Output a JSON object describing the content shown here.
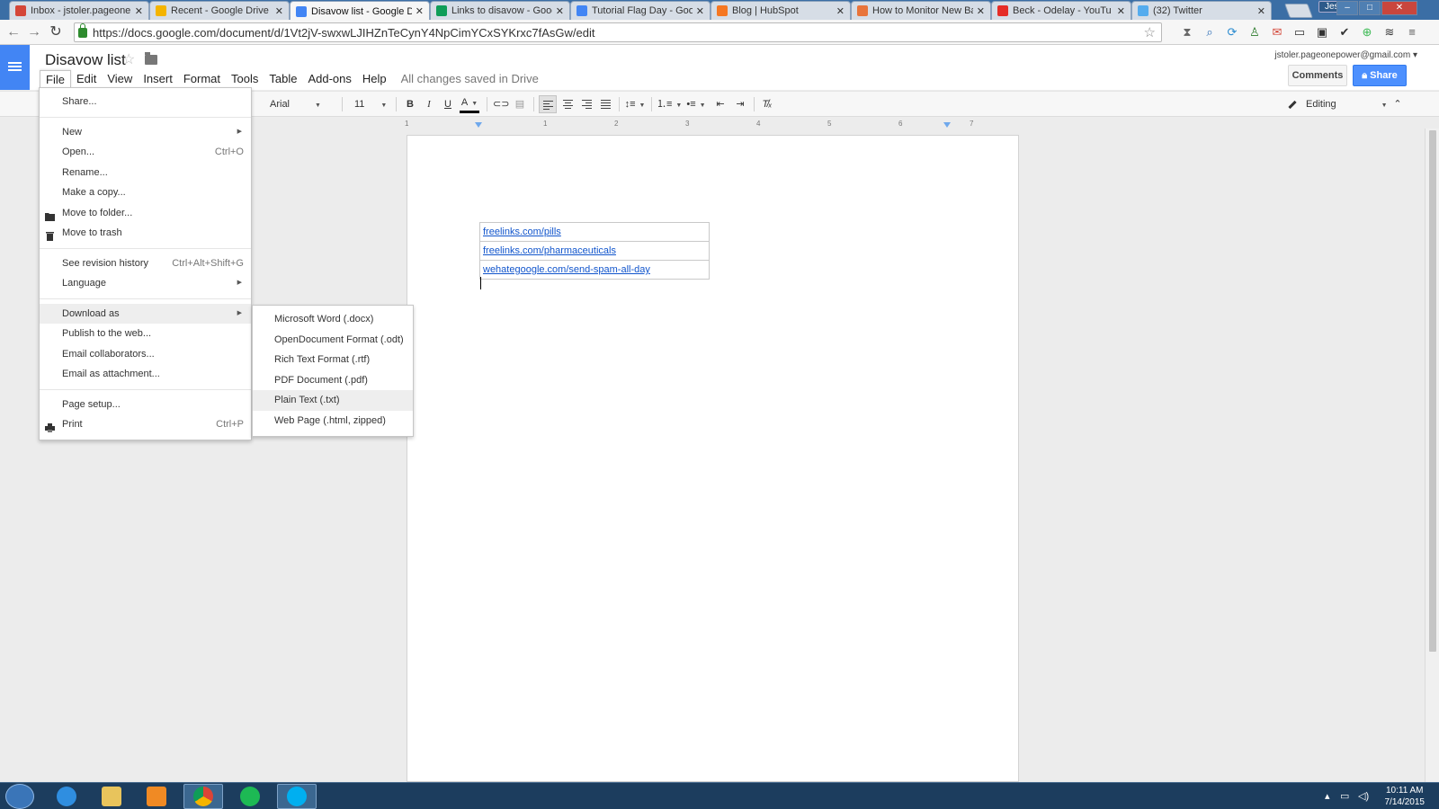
{
  "browser": {
    "tabs": [
      {
        "label": "Inbox - jstoler.pageonepo",
        "favicon_color": "#d44638",
        "icon": "gmail-icon"
      },
      {
        "label": "Recent - Google Drive",
        "favicon_color": "#f4b400",
        "icon": "drive-icon"
      },
      {
        "label": "Disavow list - Google Do",
        "favicon_color": "#4285f4",
        "icon": "docs-icon",
        "active": true
      },
      {
        "label": "Links to disavow - Google",
        "favicon_color": "#0f9d58",
        "icon": "sheets-icon"
      },
      {
        "label": "Tutorial Flag Day - Googl",
        "favicon_color": "#4285f4",
        "icon": "docs-icon"
      },
      {
        "label": "Blog | HubSpot",
        "favicon_color": "#f57722",
        "icon": "hubspot-icon"
      },
      {
        "label": "How to Monitor New Bac",
        "favicon_color": "#e8743b",
        "icon": "moz-icon"
      },
      {
        "label": "Beck - Odelay - YouTu",
        "favicon_color": "#e52d27",
        "icon": "youtube-icon"
      },
      {
        "label": "(32) Twitter",
        "favicon_color": "#55acee",
        "icon": "twitter-icon"
      }
    ],
    "close_glyph": "✕",
    "user_badge": "Jesse",
    "url": "https://docs.google.com/document/d/1Vt2jV-swxwLJIHZnTeCynY4NpCimYCxSYKrxc7fAsGw/edit"
  },
  "docs": {
    "title": "Disavow list",
    "menus": [
      "File",
      "Edit",
      "View",
      "Insert",
      "Format",
      "Tools",
      "Table",
      "Add-ons",
      "Help"
    ],
    "save_status": "All changes saved in Drive",
    "account": "jstoler.pageonepower@gmail.com",
    "comments_label": "Comments",
    "share_label": "Share",
    "font": "Arial",
    "font_size": "11",
    "mode": "Editing",
    "ruler_ticks": [
      "1",
      "1",
      "2",
      "3",
      "4",
      "5",
      "6",
      "7"
    ],
    "table_rows": [
      "freelinks.com/pills",
      "freelinks.com/pharmaceuticals",
      "wehategoogle.com/send-spam-all-day"
    ]
  },
  "file_menu": {
    "items": [
      {
        "label": "Share...",
        "shortcut": ""
      },
      {
        "sep": true
      },
      {
        "label": "New",
        "submenu": true
      },
      {
        "label": "Open...",
        "shortcut": "Ctrl+O"
      },
      {
        "label": "Rename..."
      },
      {
        "label": "Make a copy..."
      },
      {
        "label": "Move to folder...",
        "icon": "folder-icon"
      },
      {
        "label": "Move to trash",
        "icon": "trash-icon"
      },
      {
        "sep": true
      },
      {
        "label": "See revision history",
        "shortcut": "Ctrl+Alt+Shift+G"
      },
      {
        "label": "Language",
        "submenu": true
      },
      {
        "sep": true
      },
      {
        "label": "Download as",
        "submenu": true,
        "active": true
      },
      {
        "label": "Publish to the web..."
      },
      {
        "label": "Email collaborators..."
      },
      {
        "label": "Email as attachment..."
      },
      {
        "sep": true
      },
      {
        "label": "Page setup..."
      },
      {
        "label": "Print",
        "shortcut": "Ctrl+P",
        "icon": "print-icon"
      }
    ]
  },
  "download_menu": {
    "items": [
      "Microsoft Word (.docx)",
      "OpenDocument Format (.odt)",
      "Rich Text Format (.rtf)",
      "PDF Document (.pdf)",
      "Plain Text (.txt)",
      "Web Page (.html, zipped)"
    ],
    "hovered_index": 4
  },
  "taskbar": {
    "time": "10:11 AM",
    "date": "7/14/2015"
  },
  "colors": {
    "docs_blue": "#4285f4",
    "link": "#1155cc",
    "share_blue": "#4d90fe"
  }
}
